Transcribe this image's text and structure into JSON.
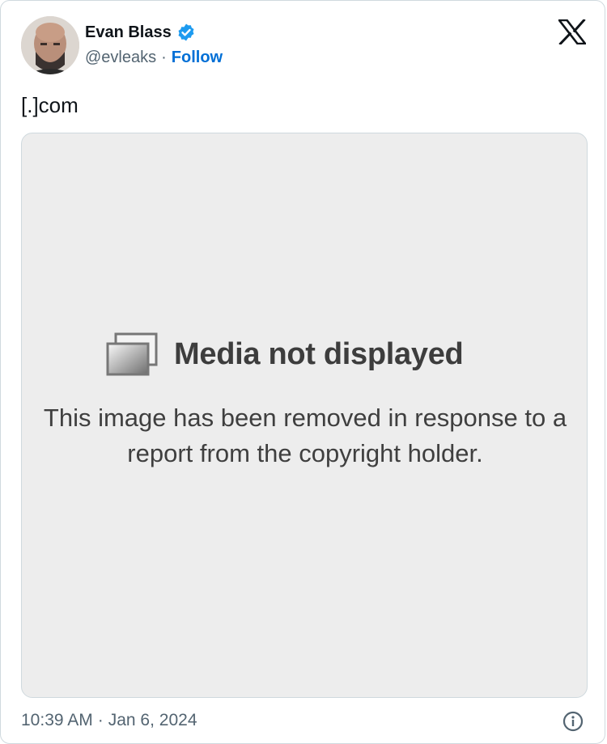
{
  "author": {
    "name": "Evan Blass",
    "handle": "@evleaks",
    "separator": "·",
    "follow_label": "Follow",
    "verified_icon": "verified-badge-icon",
    "verified_color": "#1d9bf0"
  },
  "platform_icon": "x-logo-icon",
  "tweet": {
    "text": "[.]com"
  },
  "media": {
    "icon": "photo-stack-icon",
    "title": "Media not displayed",
    "message_line1": "This image has been removed in response to a",
    "message_line2": "report from the copyright holder.",
    "background": "#ededed"
  },
  "footer": {
    "time": "10:39 AM",
    "separator": "·",
    "date": "Jan 6, 2024",
    "info_icon": "info-icon"
  },
  "colors": {
    "follow_link": "#006fd6",
    "secondary_text": "#536471",
    "border": "#cfd9de"
  }
}
